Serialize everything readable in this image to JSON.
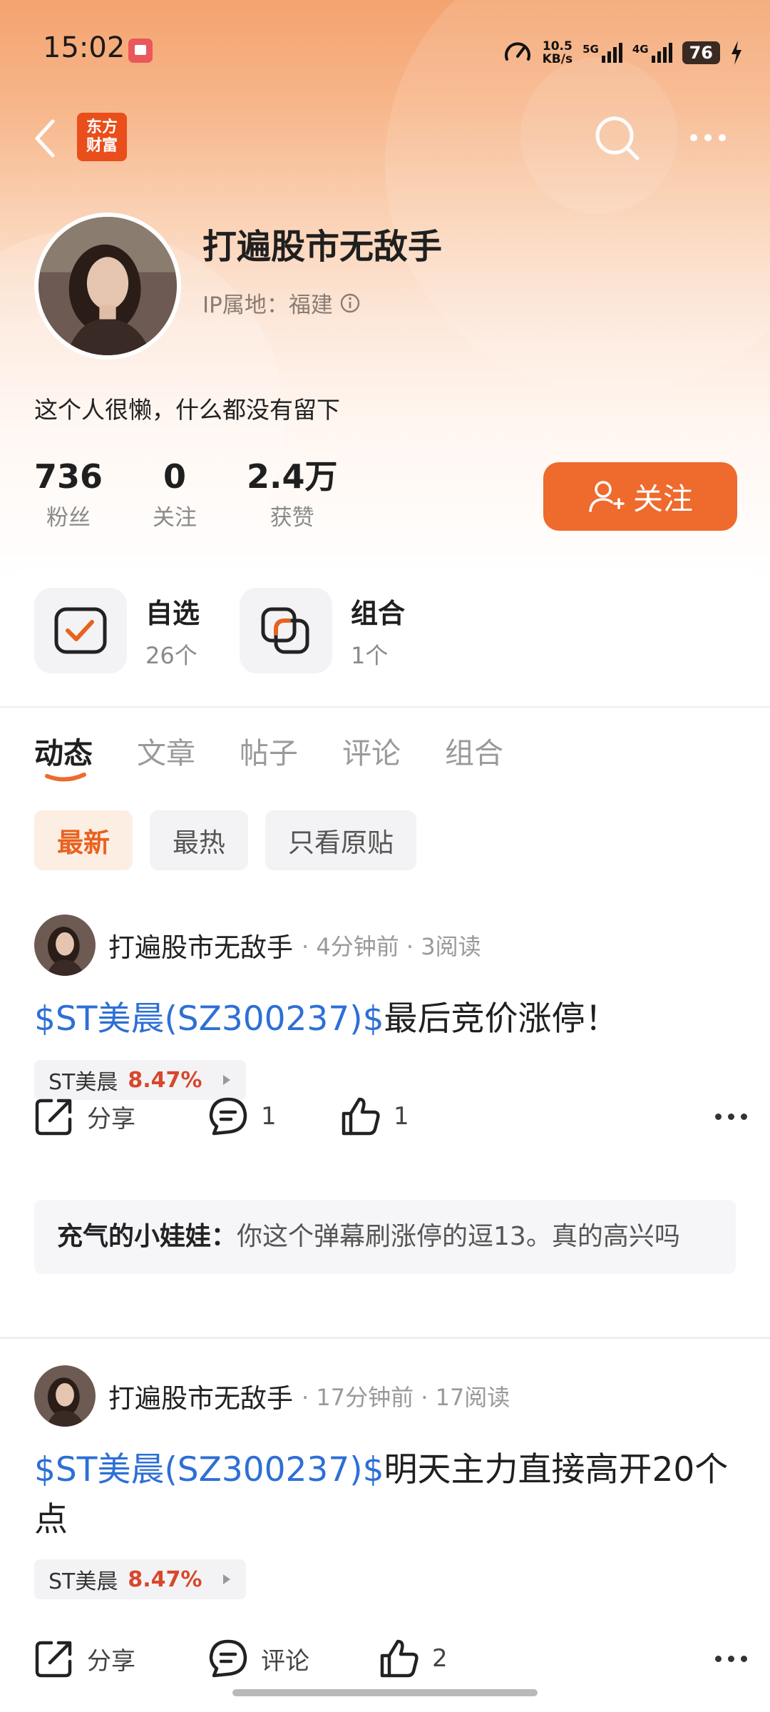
{
  "status_bar": {
    "time": "15:02",
    "net_speed_value": "10.5",
    "net_speed_unit": "KB/s",
    "signal_1": "5G",
    "signal_2": "4G",
    "battery": "76"
  },
  "nav": {
    "logo_line1": "东方",
    "logo_line2": "财富"
  },
  "profile": {
    "name": "打遍股市无敌手",
    "ip_location": "IP属地：福建",
    "bio": "这个人很懒，什么都没有留下",
    "stats": [
      {
        "value": "736",
        "label": "粉丝"
      },
      {
        "value": "0",
        "label": "关注"
      },
      {
        "value": "2.4万",
        "label": "获赞"
      }
    ],
    "follow_label": "关注"
  },
  "quick_links": [
    {
      "title": "自选",
      "count": "26个"
    },
    {
      "title": "组合",
      "count": "1个"
    }
  ],
  "tabs": [
    "动态",
    "文章",
    "帖子",
    "评论",
    "组合"
  ],
  "active_tab": "动态",
  "filters": [
    "最新",
    "最热",
    "只看原贴"
  ],
  "active_filter": "最新",
  "posts": [
    {
      "author": "打遍股市无敌手",
      "meta": "· 4分钟前 · 3阅读",
      "stock_link": "$ST美晨(SZ300237)$",
      "text": "最后竞价涨停！",
      "stock_name": "ST美晨",
      "stock_change": "8.47%",
      "share_label": "分享",
      "comment_count": "1",
      "like_count": "1",
      "top_comment": {
        "user": "充气的小娃娃：",
        "text": "你这个弹幕刷涨停的逗13。真的高兴吗"
      }
    },
    {
      "author": "打遍股市无敌手",
      "meta": "· 17分钟前 · 17阅读",
      "stock_link": "$ST美晨(SZ300237)$",
      "text": "明天主力直接高开20个点",
      "stock_name": "ST美晨",
      "stock_change": "8.47%",
      "share_label": "分享",
      "comment_label": "评论",
      "like_count": "2"
    }
  ],
  "colors": {
    "accent": "#ee6a2d",
    "link": "#2d6fd6",
    "rise": "#d8472c"
  }
}
